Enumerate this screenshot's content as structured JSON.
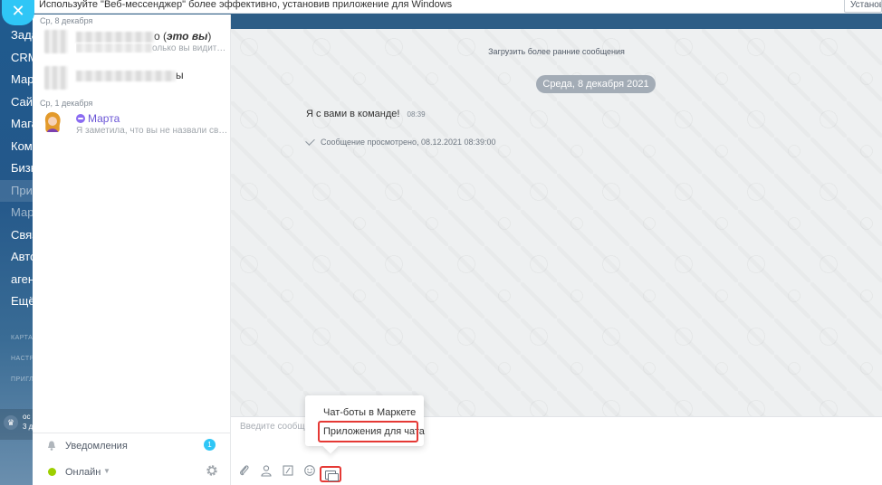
{
  "notice": {
    "text": "Используйте \"Веб-мессенджер\" более эффективно, установив приложение для Windows",
    "install_label": "Установить"
  },
  "portal_nav": {
    "items": [
      "Задачи",
      "CRM",
      "Маркетинг",
      "Сайты",
      "Магазины",
      "Компания",
      "Бизнес",
      "Приложения",
      "Маркет",
      "Связь",
      "Автоматизация",
      "агенты",
      "Ещё"
    ],
    "small_items": [
      "КАРТА",
      "НАСТРОЙКИ",
      "ПРИГЛАСИТЬ"
    ],
    "promo_text": [
      "ос",
      "3 д"
    ]
  },
  "recent": {
    "groups": [
      {
        "date": "Ср, 8 декабря",
        "items": [
          {
            "name_suffix": "о",
            "me_label": "это вы",
            "preview": "олько вы видите ..."
          },
          {
            "name_suffix": "",
            "preview": "ы"
          }
        ]
      },
      {
        "date": "Ср, 1 декабря",
        "items": [
          {
            "name": "Марта",
            "preview": "Я заметила, что вы не назвали свой..."
          }
        ]
      }
    ],
    "footer": {
      "notifications_label": "Уведомления",
      "notifications_count": "1",
      "status_label": "Онлайн"
    }
  },
  "chat": {
    "load_earlier": "Загрузить более ранние сообщения",
    "date_pill": "Среда, 8 декабря 2021",
    "message": {
      "text": "Я с вами в команде!",
      "time": "08:39"
    },
    "seen": "Сообщение просмотрено, 08.12.2021 08:39:00"
  },
  "input": {
    "placeholder": "Введите сообщение"
  },
  "popup": {
    "items": [
      "Чат-боты в Маркете",
      "Приложения для чата"
    ]
  },
  "colors": {
    "accent": "#2fc6f6",
    "highlight": "#e53935",
    "online": "#9dcf00",
    "bot_name": "#6b56d6"
  }
}
